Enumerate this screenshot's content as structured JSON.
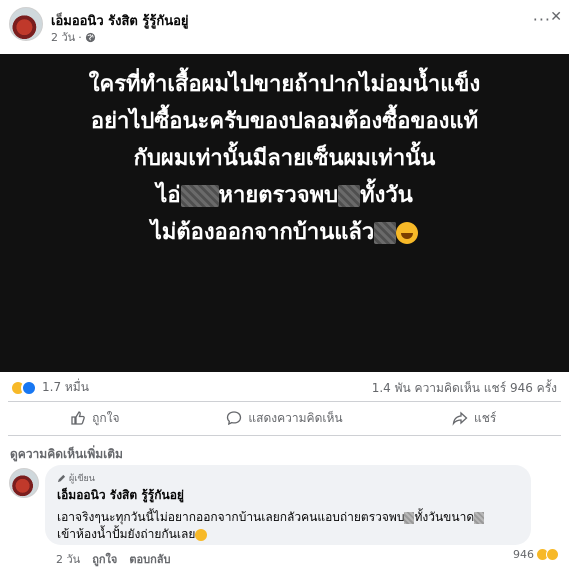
{
  "post": {
    "author": "เอ็มออนิว รังสิต รู้รู้กันอยู่",
    "time": "2 วัน",
    "privacy_icon": "globe-icon",
    "image_lines": [
      "ใครที่ทำเสื้อผมไปขายถ้าปากไม่อมน้ำแข็ง",
      "อย่าไปซื้อนะครับของปลอมต้องซื้อของแท้",
      "กับผมเท่านั้นมีลายเซ็นผมเท่านั้น",
      "ไอ่",
      "หายตรวจพบ",
      "ทั้งวัน",
      "ไม่ต้องออกจากบ้านแล้ว"
    ]
  },
  "stats": {
    "reaction_count": "1.7 หมื่น",
    "comments_shares": "1.4 พัน ความคิดเห็น   แชร์ 946 ครั้ง"
  },
  "actions": {
    "like": "ถูกใจ",
    "comment": "แสดงความคิดเห็น",
    "share": "แชร์"
  },
  "comments": {
    "more_label": "ดูความคิดเห็นเพิ่มเติม",
    "item": {
      "badge": "ผู้เขียน",
      "author": "เอ็มออนิว รังสิต รู้รู้กันอยู่",
      "line1_a": "เอาจริงๆนะทุกวันนี้ไม่อยากออกจากบ้านเลยกลัวคนแอบถ่ายตรวจพบ",
      "line1_b": "ทั้งวันขนาด",
      "line2": "เข้าห้องน้ำปั้มยังถ่ายกันเลย",
      "time": "2 วัน",
      "like": "ถูกใจ",
      "reply": "ตอบกลับ",
      "reaction_count": "946"
    }
  },
  "colors": {
    "image_bg": "#111111",
    "like_blue": "#1877f2",
    "haha_yellow": "#f7b928"
  }
}
